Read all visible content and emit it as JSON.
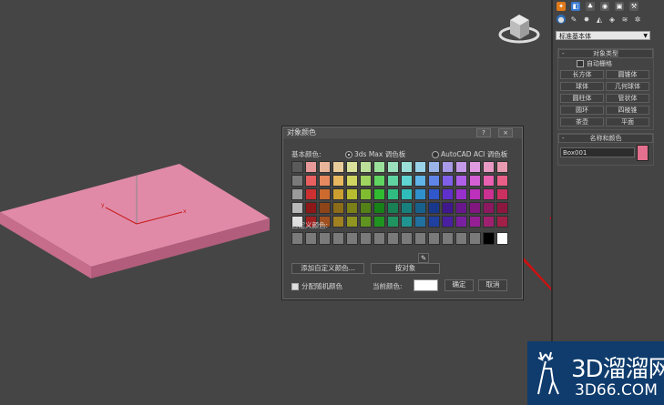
{
  "app": {
    "object_type_dropdown": "标准基本体",
    "object_type_rollout": {
      "title": "对象类型",
      "autogrid_label": "自动栅格",
      "buttons": [
        "长方体",
        "圆锥体",
        "球体",
        "几何球体",
        "圆柱体",
        "管状体",
        "圆环",
        "四棱锥",
        "茶壶",
        "平面"
      ]
    },
    "name_color_rollout": {
      "title": "名称和颜色",
      "object_name": "Box001",
      "object_color": "#e3708f"
    }
  },
  "viewport": {
    "axis_x": "x",
    "axis_y": "y",
    "axis_z": "z",
    "box_color": "#e08aa8"
  },
  "dialog": {
    "title": "对象颜色",
    "help_button": "?",
    "close_button": "×",
    "basic_colors_label": "基本颜色:",
    "palette_option_1": "3ds Max 调色板",
    "palette_option_2": "AutoCAD ACI 调色板",
    "custom_colors_label": "自定义颜色:",
    "add_custom_button": "添加自定义颜色...",
    "by_object_button": "按对象",
    "random_color_label": "分配随机颜色",
    "current_color_label": "当前颜色:",
    "current_color": "#ffffff",
    "ok_button": "确定",
    "cancel_button": "取消",
    "basic_colors": [
      [
        "#5a5a5a",
        "#e89a9a",
        "#e8b49a",
        "#e8cc9a",
        "#d8e09a",
        "#bce09a",
        "#9ae09a",
        "#9ae0bc",
        "#9ae0d8",
        "#9ad0e8",
        "#9ab4e8",
        "#a89ae8",
        "#c49ae8",
        "#e09ae0",
        "#e89ac4",
        "#e89ab0"
      ],
      [
        "#7a7a7a",
        "#e86060",
        "#e88a60",
        "#e8b860",
        "#d0d460",
        "#a0d460",
        "#60d460",
        "#60d4a0",
        "#60d4d0",
        "#60b4e8",
        "#6084e8",
        "#8060e8",
        "#b060e8",
        "#d460d4",
        "#e860b0",
        "#e86088"
      ],
      [
        "#9a9a9a",
        "#cc3030",
        "#cc6a30",
        "#cca030",
        "#b8bc30",
        "#80bc30",
        "#30bc30",
        "#30bc80",
        "#30bcb8",
        "#3090cc",
        "#3058cc",
        "#6030cc",
        "#9830cc",
        "#bc30bc",
        "#cc3090",
        "#cc3060"
      ],
      [
        "#b8b8b8",
        "#8c1818",
        "#8c4418",
        "#8c6c18",
        "#7c8018",
        "#548018",
        "#188018",
        "#188054",
        "#18807c",
        "#18608c",
        "#18388c",
        "#40188c",
        "#68188c",
        "#801880",
        "#8c1860",
        "#8c1840"
      ],
      [
        "#e0e0e0",
        "#a02020",
        "#a05020",
        "#a08020",
        "#909420",
        "#609420",
        "#209420",
        "#209460",
        "#209490",
        "#2070a0",
        "#2040a0",
        "#4820a0",
        "#7820a0",
        "#942094",
        "#a02070",
        "#a02048"
      ]
    ],
    "custom_colors": [
      "#7a7a7a",
      "#7a7a7a",
      "#7a7a7a",
      "#7a7a7a",
      "#7a7a7a",
      "#7a7a7a",
      "#7a7a7a",
      "#7a7a7a",
      "#7a7a7a",
      "#7a7a7a",
      "#7a7a7a",
      "#7a7a7a",
      "#7a7a7a",
      "#7a7a7a",
      "#000000",
      "#ffffff"
    ]
  },
  "watermark": {
    "line1": "3D溜溜网",
    "line2": "3D66.COM"
  }
}
